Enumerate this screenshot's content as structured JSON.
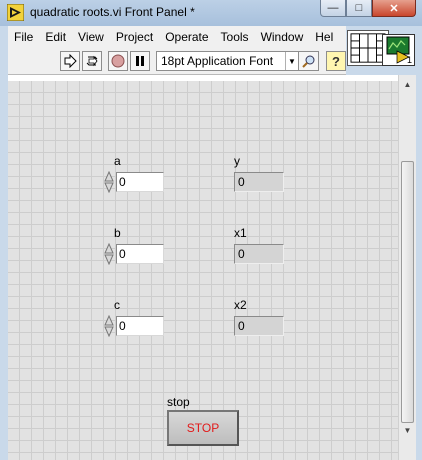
{
  "window": {
    "title": "quadratic roots.vi Front Panel *",
    "controls": {
      "minimize": "—",
      "maximize": "□",
      "close": "✕"
    }
  },
  "menu": [
    "File",
    "Edit",
    "View",
    "Project",
    "Operate",
    "Tools",
    "Window",
    "Hel"
  ],
  "toolbar": {
    "font_label": "18pt Application Font",
    "buttons": [
      "run-arrow",
      "run-continuously",
      "abort",
      "pause",
      "search",
      "context-help"
    ]
  },
  "vi_icon": {
    "badge": "1"
  },
  "controls": {
    "a": {
      "label": "a",
      "value": "0"
    },
    "b": {
      "label": "b",
      "value": "0"
    },
    "c": {
      "label": "c",
      "value": "0"
    }
  },
  "indicators": {
    "y": {
      "label": "y",
      "value": "0"
    },
    "x1": {
      "label": "x1",
      "value": "0"
    },
    "x2": {
      "label": "x2",
      "value": "0"
    }
  },
  "stop": {
    "label": "stop",
    "button_text": "STOP"
  },
  "colors": {
    "stop_text": "#e21a1a",
    "panel_grid": "#e2e2e2"
  }
}
